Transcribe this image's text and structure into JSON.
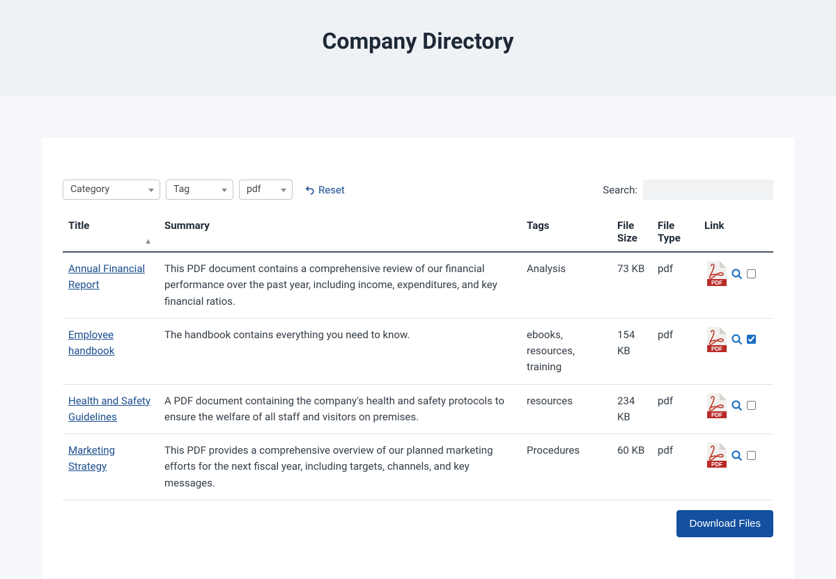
{
  "header": {
    "title": "Company Directory"
  },
  "filters": {
    "category_label": "Category",
    "tag_label": "Tag",
    "doctype_label": "pdf",
    "reset_label": "Reset"
  },
  "search": {
    "label": "Search:",
    "value": ""
  },
  "columns": {
    "title": "Title",
    "summary": "Summary",
    "tags": "Tags",
    "filesize": "File Size",
    "filetype": "File Type",
    "link": "Link"
  },
  "rows": [
    {
      "title": "Annual Financial Report",
      "summary": "This PDF document contains a comprehensive review of our financial performance over the past year, including income, expenditures, and key financial ratios.",
      "tags": "Analysis",
      "filesize": "73 KB",
      "filetype": "pdf",
      "checked": false
    },
    {
      "title": "Employee handbook",
      "summary": "The handbook contains everything you need to know.",
      "tags": "ebooks, resources, training",
      "filesize": "154 KB",
      "filetype": "pdf",
      "checked": true
    },
    {
      "title": "Health and Safety Guidelines",
      "summary": "A PDF document containing the company's health and safety protocols to ensure the welfare of all staff and visitors on premises.",
      "tags": "resources",
      "filesize": "234 KB",
      "filetype": "pdf",
      "checked": false
    },
    {
      "title": "Marketing Strategy",
      "summary": "This PDF provides a comprehensive overview of our planned marketing efforts for the next fiscal year, including targets, channels, and key messages.",
      "tags": "Procedures",
      "filesize": "60 KB",
      "filetype": "pdf",
      "checked": false
    }
  ],
  "footer": {
    "download_label": "Download Files"
  }
}
